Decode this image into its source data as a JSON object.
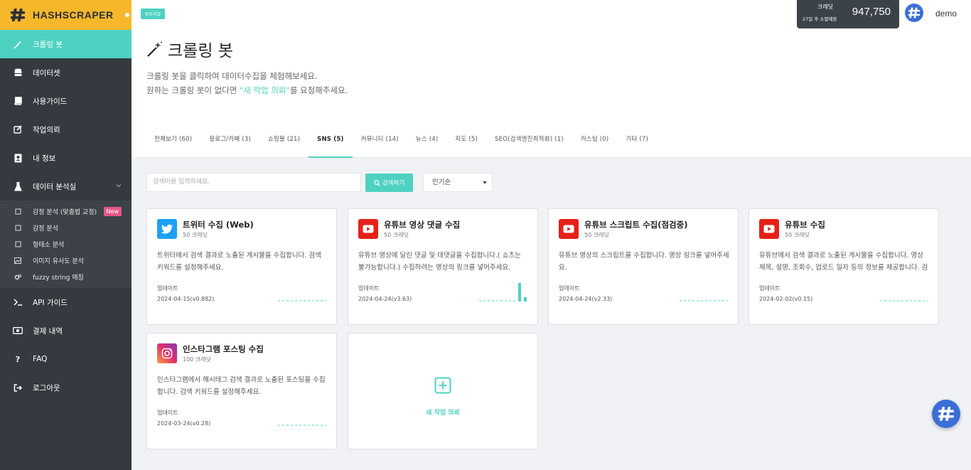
{
  "brand": {
    "name": "HASHSCRAPER",
    "logo_icon": "hash-logo-icon"
  },
  "sidebar": {
    "items": [
      {
        "label": "크롤링 봇",
        "icon": "magic-wand-icon"
      },
      {
        "label": "데이터셋",
        "icon": "database-icon"
      },
      {
        "label": "사용가이드",
        "icon": "book-icon"
      },
      {
        "label": "작업의뢰",
        "icon": "edit-icon"
      },
      {
        "label": "내 정보",
        "icon": "user-card-icon"
      },
      {
        "label": "데이터 분석실",
        "icon": "flask-icon"
      }
    ],
    "sub_items": [
      {
        "label": "감정 분석 (맞춤법 교정)",
        "badge": "New"
      },
      {
        "label": "감정 분석"
      },
      {
        "label": "형태소 분석"
      },
      {
        "label": "이미지 유사도 분석"
      },
      {
        "label": "fuzzy string 매칭"
      }
    ],
    "bottom_items": [
      {
        "label": "API 가이드",
        "icon": "terminal-icon"
      },
      {
        "label": "결제 내역",
        "icon": "money-icon"
      },
      {
        "label": "FAQ",
        "icon": "question-icon"
      },
      {
        "label": "로그아웃",
        "icon": "logout-icon"
      }
    ]
  },
  "header": {
    "tutorial": "튜토리얼",
    "credit_label": "크레딧",
    "credit_sub": "27일 후 소멸예정",
    "credit_value": "947,750",
    "username": "demo"
  },
  "page": {
    "title": "크롤링 봇",
    "desc_line1": "크롤링 봇을 클릭하여 데이터수집을 체험해보세요.",
    "desc_line2_pre": "원하는 크롤링 봇이 없다면 ",
    "desc_line2_link": "\"새 작업 의뢰\"",
    "desc_line2_post": "를 요청해주세요."
  },
  "tabs": [
    "전체보기 (60)",
    "블로그/카페 (3)",
    "쇼핑몰 (21)",
    "SNS (5)",
    "커뮤니티 (14)",
    "뉴스 (4)",
    "지도 (5)",
    "SEO(검색엔진최적화) (1)",
    "커스텀 (0)",
    "기타 (7)"
  ],
  "active_tab_index": 3,
  "search": {
    "placeholder": "검색어를 입력하세요.",
    "button": "검색하기",
    "sort": "인기순"
  },
  "cards": [
    {
      "title": "트위터 수집 (Web)",
      "credit": "50 크레딧",
      "desc": "트위터에서 검색 결과로 노출된 게시물을 수집합니다. 검색 키워드를 설정해주세요.",
      "updated_label": "업데이트",
      "version": "2024-04-15(v0.882)",
      "icon": "twitter-icon",
      "color": "#1da1f2"
    },
    {
      "title": "유튜브 영상 댓글 수집",
      "credit": "50 크레딧",
      "desc": "유튜브 영상에 달린 댓글 및 대댓글을 수집합니다.( 쇼츠는 불가능합니다.) 수집하려는 영상의 링크를 넣어주세요.",
      "updated_label": "업데이트",
      "version": "2024-04-24(v3.63)",
      "icon": "youtube-icon",
      "color": "#e62117"
    },
    {
      "title": "유튜브 스크립트 수집(점검중)",
      "credit": "50 크레딧",
      "desc": "유튜브 영상의 스크립트를 수집합니다. 영상 링크를 넣어주세요.",
      "updated_label": "업데이트",
      "version": "2024-04-24(v2.33)",
      "icon": "youtube-icon",
      "color": "#e62117"
    },
    {
      "title": "유튜브 수집",
      "credit": "50 크레딧",
      "desc": "유튜브에서 검색 결과로 노출된 게시물을 수집합니다. 영상 제목, 설명, 조회수, 업로드 일자 등의 정보를 제공합니다. 검색…",
      "updated_label": "업데이트",
      "version": "2024-02-02(v0.15)",
      "icon": "youtube-icon",
      "color": "#e62117"
    },
    {
      "title": "인스타그램 포스팅 수집",
      "credit": "100 크레딧",
      "desc": "인스타그램에서 해시태그 검색 결과로 노출된 포스팅을 수집합니다. 검색 키워드를 설정해주세요.",
      "updated_label": "업데이트",
      "version": "2024-03-24(v0.28)",
      "icon": "instagram-icon",
      "color": "#c13584"
    }
  ],
  "new_request": {
    "label": "새 작업 의뢰",
    "icon": "plus-square-icon"
  },
  "colors": {
    "accent": "#4fd1c1",
    "brand": "#f6b72a",
    "sidebar": "#343a40"
  }
}
